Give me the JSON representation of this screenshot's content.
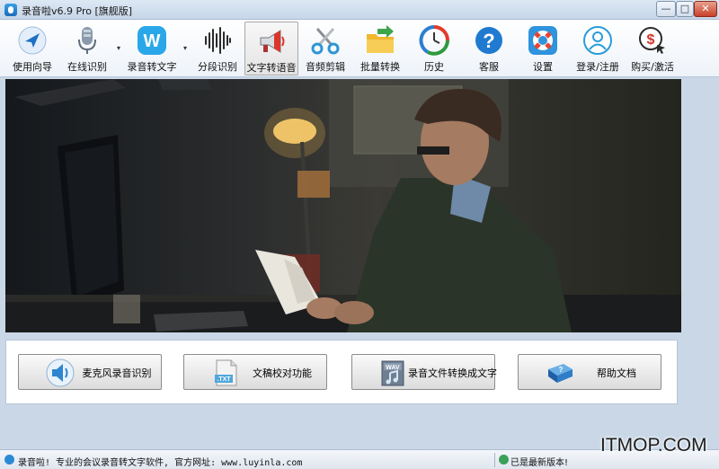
{
  "window": {
    "title": "录音啦v6.9 Pro [旗舰版]",
    "min_glyph": "—",
    "max_glyph": "□",
    "close_glyph": "✕"
  },
  "toolbar": {
    "items": [
      {
        "label": "使用向导",
        "icon": "navigation-arrow-icon"
      },
      {
        "label": "在线识别",
        "icon": "microphone-icon"
      },
      {
        "label": "录音转文字",
        "icon": "w-logo-icon"
      },
      {
        "label": "分段识别",
        "icon": "waveform-icon"
      },
      {
        "label": "文字转语音",
        "icon": "megaphone-icon"
      },
      {
        "label": "音频剪辑",
        "icon": "scissors-icon"
      },
      {
        "label": "批量转换",
        "icon": "folder-arrow-icon"
      },
      {
        "label": "历史",
        "icon": "history-clock-icon"
      },
      {
        "label": "客服",
        "icon": "help-question-icon"
      },
      {
        "label": "设置",
        "icon": "lifebuoy-icon"
      },
      {
        "label": "登录/注册",
        "icon": "user-icon"
      },
      {
        "label": "购买/激活",
        "icon": "dollar-cursor-icon"
      }
    ],
    "dropdown_glyph": "▾",
    "active_index": 4
  },
  "features": [
    {
      "label": "麦克风录音识别",
      "icon": "speaker-icon"
    },
    {
      "label": "文稿校对功能",
      "icon": "txt-file-icon"
    },
    {
      "label": "录音文件转换成文字",
      "icon": "wav-file-icon"
    },
    {
      "label": "帮助文档",
      "icon": "help-book-icon"
    }
  ],
  "status": {
    "left_text": "录音啦! 专业的会议录音转文字软件, 官方网址: www.luyinla.com",
    "right_text": "已是最新版本!"
  },
  "watermark": "ITMOP.COM",
  "colors": {
    "accent_blue": "#2a8ad4",
    "close_red": "#c8412b",
    "status_ok_green": "#3aa05a"
  }
}
